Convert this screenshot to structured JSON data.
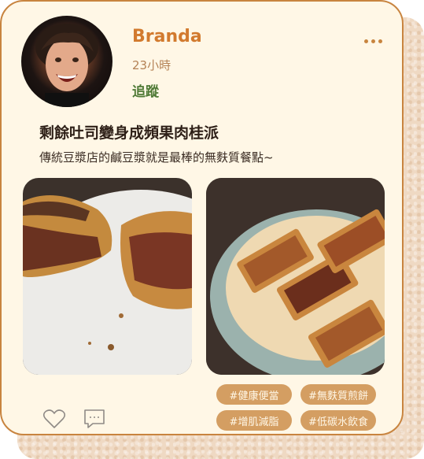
{
  "post": {
    "author_name": "Branda",
    "time_ago": "23小時",
    "follow_label": "追蹤",
    "title": "剩餘吐司變身成頻果肉桂派",
    "description": "傳統豆漿店的鹹豆漿就是最棒的無麩質餐點~"
  },
  "tags": [
    "#健康便當",
    "#無麩質煎餅",
    "#增肌減脂",
    "#低碳水飲食"
  ],
  "icons": {
    "more": "more-dots-icon",
    "like": "heart-icon",
    "comment": "comment-icon"
  },
  "colors": {
    "accent": "#d27a2e",
    "follow": "#4f7a36",
    "card_bg": "#fff7e6",
    "border": "#c8843f",
    "tag_bg": "#d49e62"
  }
}
